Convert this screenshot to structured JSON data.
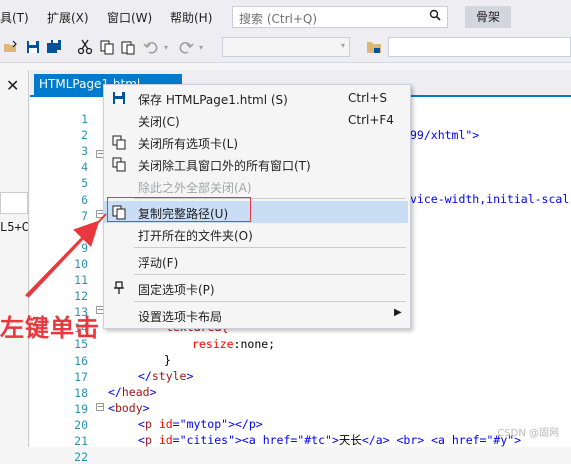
{
  "menubar": {
    "items": [
      "具(T)",
      "扩展(X)",
      "窗口(W)",
      "帮助(H)"
    ],
    "search_placeholder": "搜索 (Ctrl+Q)",
    "solution_label": "骨架"
  },
  "left_panel": {
    "close": "✕",
    "text": "L5+C"
  },
  "tab": {
    "label": "HTMLPage1.html"
  },
  "editor": {
    "line_numbers": [
      "1",
      "2",
      "3",
      "4",
      "5",
      "6",
      "7",
      "8",
      "9",
      "10",
      "11",
      "12",
      "13",
      "14",
      "15",
      "16",
      "17",
      "18",
      "19",
      "20",
      "21",
      "22"
    ],
    "visible_fragments": {
      "line2_tail": "99/xhtml\">",
      "line8_tail": "vice-width,initial-scal",
      "line15": "textarea{",
      "line16_prop": "resize",
      "line16_val": ":none;",
      "line17": "}",
      "line18_open": "</",
      "line18_tag": "style",
      "line18_close": ">",
      "line19_open": "</",
      "line19_tag": "head",
      "line19_close": ">",
      "line20_open": "<",
      "line20_tag": "body",
      "line20_close": ">",
      "line21_p": "p",
      "line21_id": "id",
      "line21_val": "\"mytop\"",
      "line21_end": "></p>",
      "line22_p": "p",
      "line22_id": "id",
      "line22_val": "\"cities\"",
      "line22_a": "><a href=\"#tc\">",
      "line22_text": "天长",
      "line22_rest": "</a> <br> <a href=\"#y\">"
    }
  },
  "context_menu": {
    "items": [
      {
        "label": "保存 HTMLPage1.html (S)",
        "shortcut": "Ctrl+S",
        "icon": "save-icon",
        "disabled": false
      },
      {
        "label": "关闭(C)",
        "shortcut": "Ctrl+F4",
        "icon": "",
        "disabled": false
      },
      {
        "label": "关闭所有选项卡(L)",
        "shortcut": "",
        "icon": "close-tabs-icon",
        "disabled": false
      },
      {
        "label": "关闭除工具窗口外的所有窗口(T)",
        "shortcut": "",
        "icon": "close-windows-icon",
        "disabled": false
      },
      {
        "label": "除此之外全部关闭(A)",
        "shortcut": "",
        "icon": "",
        "disabled": true
      },
      {
        "label": "复制完整路径(U)",
        "shortcut": "",
        "icon": "copy-icon",
        "disabled": false
      },
      {
        "label": "打开所在的文件夹(O)",
        "shortcut": "",
        "icon": "",
        "disabled": false
      },
      {
        "label": "浮动(F)",
        "shortcut": "",
        "icon": "",
        "disabled": false
      },
      {
        "label": "固定选项卡(P)",
        "shortcut": "",
        "icon": "pin-icon",
        "disabled": false
      },
      {
        "label": "设置选项卡布局",
        "shortcut": "",
        "icon": "",
        "disabled": false
      }
    ]
  },
  "annotation": {
    "text": "左键单击"
  },
  "watermark": "CSDN @固网",
  "colors": {
    "accent": "#007acc",
    "annotation_red": "#e8383d",
    "highlight": "#c9def5"
  }
}
